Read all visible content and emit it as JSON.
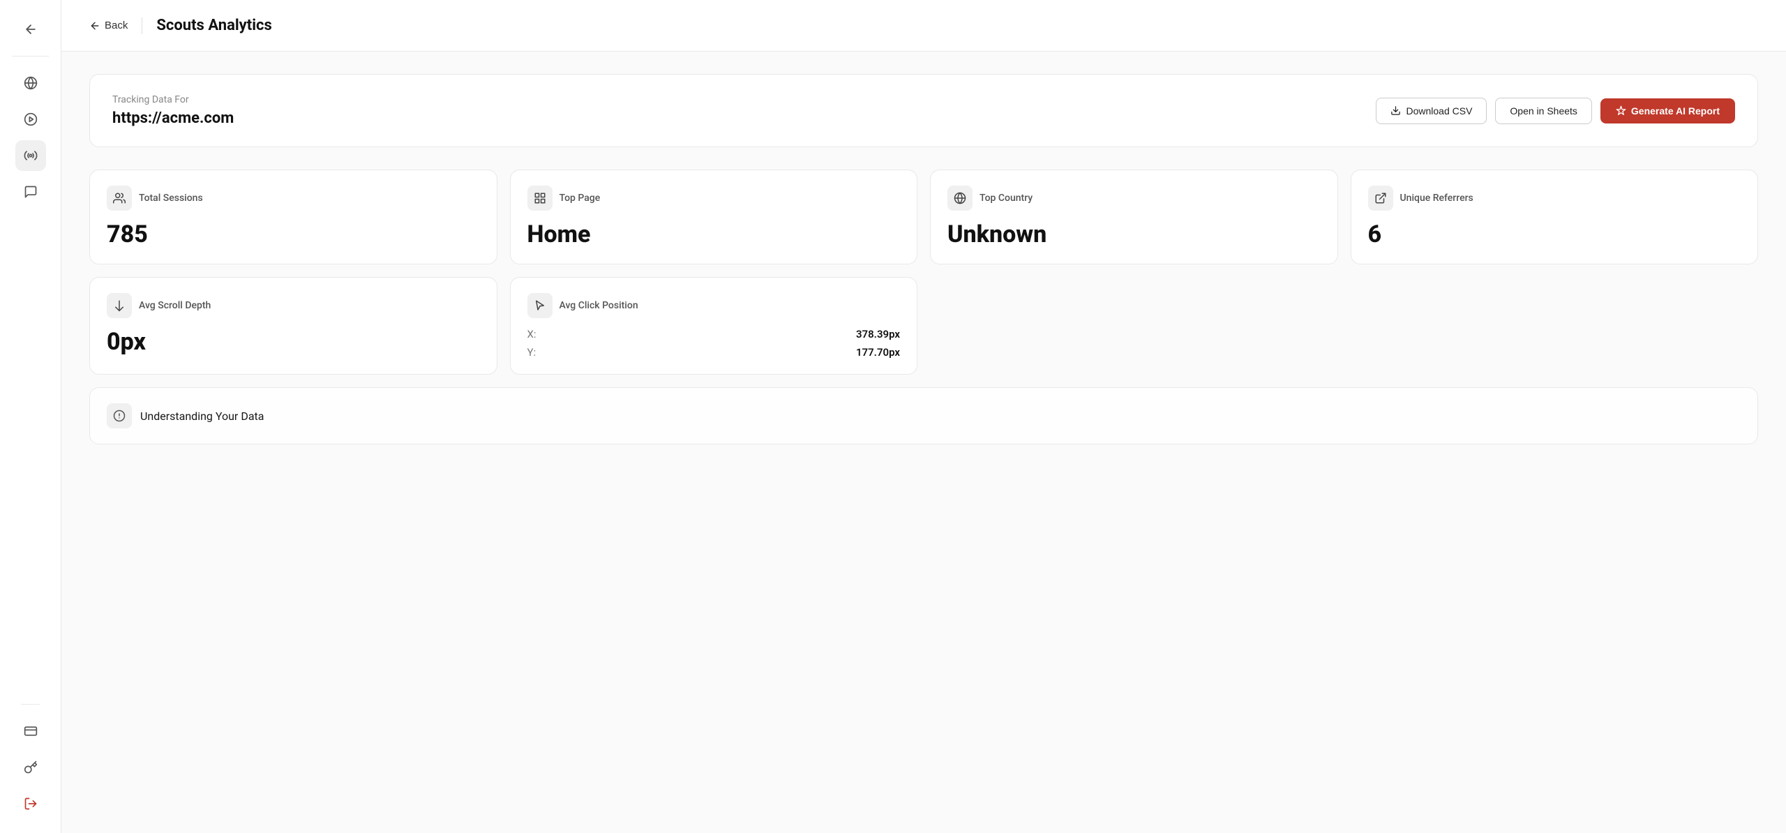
{
  "sidebar": {
    "icons": [
      {
        "name": "back-arrow-icon",
        "symbol": "←",
        "active": false
      },
      {
        "name": "globe-icon",
        "symbol": "🌐",
        "active": false
      },
      {
        "name": "play-icon",
        "symbol": "▶",
        "active": false
      },
      {
        "name": "broadcast-icon",
        "symbol": "📡",
        "active": true
      },
      {
        "name": "chat-icon",
        "symbol": "💬",
        "active": false
      }
    ],
    "bottom_icons": [
      {
        "name": "billing-icon",
        "symbol": "🧾",
        "active": false
      },
      {
        "name": "key-icon",
        "symbol": "🔑",
        "active": false
      },
      {
        "name": "logout-icon",
        "symbol": "→",
        "active": false,
        "color": "#c0392b"
      }
    ]
  },
  "header": {
    "back_label": "Back",
    "title": "Scouts Analytics"
  },
  "tracking": {
    "label": "Tracking Data For",
    "url": "https://acme.com",
    "download_csv_label": "Download CSV",
    "open_sheets_label": "Open in Sheets",
    "generate_report_label": "Generate AI Report"
  },
  "stats": [
    {
      "id": "total-sessions",
      "icon": "users-icon",
      "label": "Total Sessions",
      "value": "785"
    },
    {
      "id": "top-page",
      "icon": "grid-icon",
      "label": "Top Page",
      "value": "Home"
    },
    {
      "id": "top-country",
      "icon": "globe-stat-icon",
      "label": "Top Country",
      "value": "Unknown"
    },
    {
      "id": "unique-referrers",
      "icon": "external-link-icon",
      "label": "Unique Referrers",
      "value": "6"
    }
  ],
  "stats_row2": [
    {
      "id": "avg-scroll-depth",
      "icon": "scroll-down-icon",
      "label": "Avg Scroll Depth",
      "value": "0px"
    }
  ],
  "click_position": {
    "icon": "cursor-icon",
    "label": "Avg Click Position",
    "x_label": "X:",
    "x_value": "378.39px",
    "y_label": "Y:",
    "y_value": "177.70px"
  },
  "bottom_peek": {
    "icon": "info-icon",
    "label": "Understanding Your Data"
  }
}
